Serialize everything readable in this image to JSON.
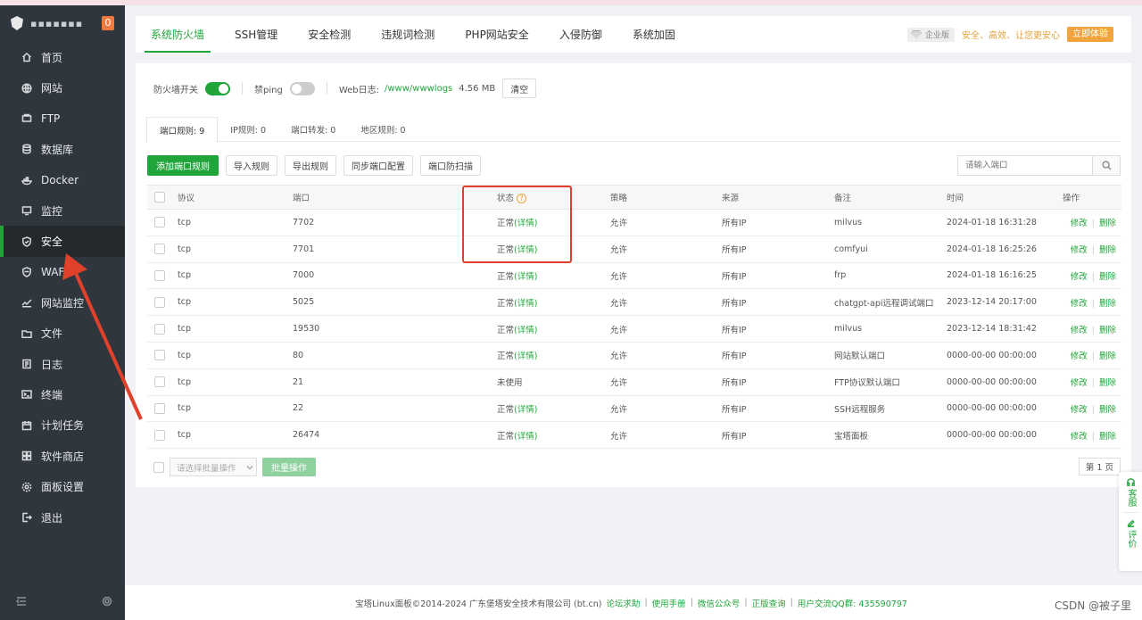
{
  "sidebar": {
    "host": "▪▪▪▪▪▪▪",
    "badge": "0",
    "items": [
      {
        "label": "首页",
        "icon": "home-icon"
      },
      {
        "label": "网站",
        "icon": "globe-icon"
      },
      {
        "label": "FTP",
        "icon": "ftp-icon"
      },
      {
        "label": "数据库",
        "icon": "database-icon"
      },
      {
        "label": "Docker",
        "icon": "docker-icon"
      },
      {
        "label": "监控",
        "icon": "monitor-icon"
      },
      {
        "label": "安全",
        "icon": "shield-icon"
      },
      {
        "label": "WAF",
        "icon": "waf-icon"
      },
      {
        "label": "网站监控",
        "icon": "chart-icon"
      },
      {
        "label": "文件",
        "icon": "folder-icon"
      },
      {
        "label": "日志",
        "icon": "log-icon"
      },
      {
        "label": "终端",
        "icon": "terminal-icon"
      },
      {
        "label": "计划任务",
        "icon": "calendar-icon"
      },
      {
        "label": "软件商店",
        "icon": "store-icon"
      },
      {
        "label": "面板设置",
        "icon": "settings-icon"
      },
      {
        "label": "退出",
        "icon": "logout-icon"
      }
    ],
    "active_index": 6
  },
  "tabs": [
    "系统防火墙",
    "SSH管理",
    "安全检测",
    "违规词检测",
    "PHP网站安全",
    "入侵防御",
    "系统加固"
  ],
  "promo": {
    "edition": "企业版",
    "text": "安全、高效、让您更安心",
    "button": "立即体验"
  },
  "controls": {
    "firewall_label": "防火墙开关",
    "ping_label": "禁ping",
    "weblog_label": "Web日志:",
    "weblog_path": "/www/wwwlogs",
    "weblog_size": "4.56 MB",
    "clear_button": "清空"
  },
  "subtabs": [
    "端口规则: 9",
    "IP规则: 0",
    "端口转发: 0",
    "地区规则: 0"
  ],
  "toolbar": [
    "添加端口规则",
    "导入规则",
    "导出规则",
    "同步端口配置",
    "端口防扫描"
  ],
  "search": {
    "placeholder": "请输入端口"
  },
  "table": {
    "headers": {
      "protocol": "协议",
      "port": "端口",
      "status": "状态",
      "policy": "策略",
      "source": "来源",
      "remark": "备注",
      "time": "时间",
      "ops": "操作"
    },
    "rows": [
      {
        "protocol": "tcp",
        "port": "7702",
        "status": "正常",
        "detail": "(详情)",
        "policy": "允许",
        "source": "所有IP",
        "remark": "milvus",
        "time": "2024-01-18 16:31:28"
      },
      {
        "protocol": "tcp",
        "port": "7701",
        "status": "正常",
        "detail": "(详情)",
        "policy": "允许",
        "source": "所有IP",
        "remark": "comfyui",
        "time": "2024-01-18 16:25:26"
      },
      {
        "protocol": "tcp",
        "port": "7000",
        "status": "正常",
        "detail": "(详情)",
        "policy": "允许",
        "source": "所有IP",
        "remark": "frp",
        "time": "2024-01-18 16:16:25"
      },
      {
        "protocol": "tcp",
        "port": "5025",
        "status": "正常",
        "detail": "(详情)",
        "policy": "允许",
        "source": "所有IP",
        "remark": "chatgpt-api远程调试端口",
        "time": "2023-12-14 20:17:00"
      },
      {
        "protocol": "tcp",
        "port": "19530",
        "status": "正常",
        "detail": "(详情)",
        "policy": "允许",
        "source": "所有IP",
        "remark": "milvus",
        "time": "2023-12-14 18:31:42"
      },
      {
        "protocol": "tcp",
        "port": "80",
        "status": "正常",
        "detail": "(详情)",
        "policy": "允许",
        "source": "所有IP",
        "remark": "网站默认端口",
        "time": "0000-00-00 00:00:00"
      },
      {
        "protocol": "tcp",
        "port": "21",
        "status": "未使用",
        "detail": "",
        "policy": "允许",
        "source": "所有IP",
        "remark": "FTP协议默认端口",
        "time": "0000-00-00 00:00:00"
      },
      {
        "protocol": "tcp",
        "port": "22",
        "status": "正常",
        "detail": "(详情)",
        "policy": "允许",
        "source": "所有IP",
        "remark": "SSH远程服务",
        "time": "0000-00-00 00:00:00"
      },
      {
        "protocol": "tcp",
        "port": "26474",
        "status": "正常",
        "detail": "(详情)",
        "policy": "允许",
        "source": "所有IP",
        "remark": "宝塔面板",
        "time": "0000-00-00 00:00:00"
      }
    ],
    "edit_label": "修改",
    "delete_label": "删除"
  },
  "batch": {
    "placeholder": "请选择批量操作",
    "button": "批量操作"
  },
  "pager": "第 1 页",
  "footer": {
    "copyright": "宝塔Linux面板©2014-2024 广东堡塔安全技术有限公司 (bt.cn)",
    "links": [
      "论坛求助",
      "使用手册",
      "微信公众号",
      "正版查询",
      "用户交流QQ群: 435590797"
    ]
  },
  "float_widget": [
    "客服",
    "评价"
  ],
  "watermark": "CSDN @被子里",
  "colors": {
    "accent": "#20a53a",
    "annotation": "#e0412a",
    "sidebar": "#30363d"
  }
}
